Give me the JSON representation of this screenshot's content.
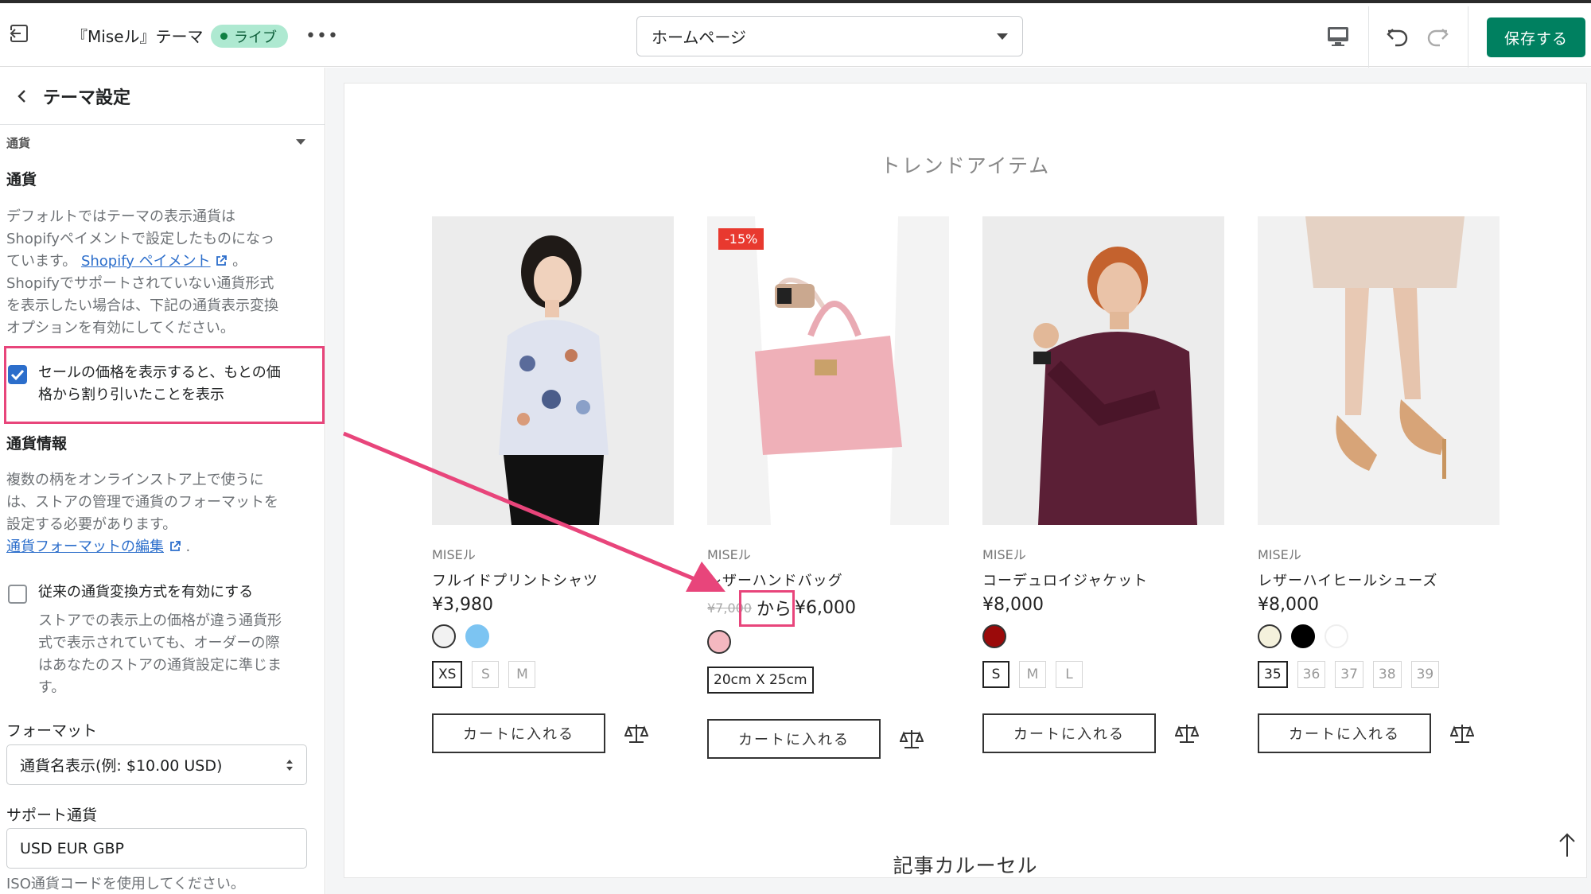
{
  "topbar": {
    "theme_name": "『Miseル』テーマ",
    "live_label": "ライブ",
    "more_label": "•••",
    "page_select": "ホームページ",
    "save_label": "保存する"
  },
  "sidebar": {
    "title": "テーマ設定",
    "section_header": "通貨",
    "currency_heading": "通貨",
    "currency_desc_1": "デフォルトではテーマの表示通貨は",
    "currency_desc_2": "Shopifyペイメントで設定したものになっ",
    "currency_desc_3a": "ています。",
    "currency_link": "Shopify ペイメント",
    "currency_desc_3b": "。",
    "currency_desc_4": "Shopifyでサポートされていない通貨形式",
    "currency_desc_5": "を表示したい場合は、下記の通貨表示変換",
    "currency_desc_6": "オプションを有効にしてください。",
    "sale_checkbox_line1": "セールの価格を表示すると、もとの価",
    "sale_checkbox_line2": "格から割り引いたことを表示",
    "sale_checkbox_checked": true,
    "currency_info_heading": "通貨情報",
    "info_desc_1": "複数の柄をオンラインストア上で使うに",
    "info_desc_2": "は、ストアの管理で通貨のフォーマットを",
    "info_desc_3": "設定する必要があります。",
    "info_link": "通貨フォーマットの編集",
    "info_link_suffix": ".",
    "legacy_checkbox_label": "従来の通貨変換方式を有効にする",
    "legacy_checkbox_checked": false,
    "legacy_desc_1": "ストアでの表示上の価格が違う通貨形",
    "legacy_desc_2": "式で表示されていても、オーダーの際",
    "legacy_desc_3": "はあなたのストアの通貨設定に準じま",
    "legacy_desc_4": "す。",
    "format_label": "フォーマット",
    "format_value": "通貨名表示(例: $10.00 USD)",
    "supported_label": "サポート通貨",
    "supported_value": "USD EUR GBP",
    "iso_help": "ISO通貨コードを使用してください。"
  },
  "preview": {
    "section_title": "トレンドアイテム",
    "next_section_title": "記事カルーセル",
    "products": [
      {
        "brand": "MISEル",
        "name": "フルイドプリントシャツ",
        "price": "¥3,980",
        "swatches": [
          "#f2f2f2",
          "#7cc4f2"
        ],
        "sizes": [
          "XS",
          "S",
          "M"
        ],
        "cart_label": "カートに入れる"
      },
      {
        "brand": "MISEル",
        "name": "レザーハンドバッグ",
        "badge": "-15%",
        "old_price": "¥7,000",
        "from_label": "から",
        "price": "¥6,000",
        "swatches": [
          "#f4b8c0"
        ],
        "sizes": [
          "20cm X 25cm"
        ],
        "cart_label": "カートに入れる"
      },
      {
        "brand": "MISEル",
        "name": "コーデュロイジャケット",
        "price": "¥8,000",
        "swatches": [
          "#9b0a0a"
        ],
        "sizes": [
          "S",
          "M",
          "L"
        ],
        "cart_label": "カートに入れる"
      },
      {
        "brand": "MISEル",
        "name": "レザーハイヒールシューズ",
        "price": "¥8,000",
        "swatches": [
          "#f4f1dc",
          "#000000",
          "#ffffff"
        ],
        "sizes": [
          "35",
          "36",
          "37",
          "38",
          "39"
        ],
        "cart_label": "カートに入れる"
      }
    ]
  },
  "colors": {
    "accent": "#008060",
    "annotation": "#e8457b",
    "link": "#2c6ecb",
    "sale_badge": "#e8392f"
  }
}
